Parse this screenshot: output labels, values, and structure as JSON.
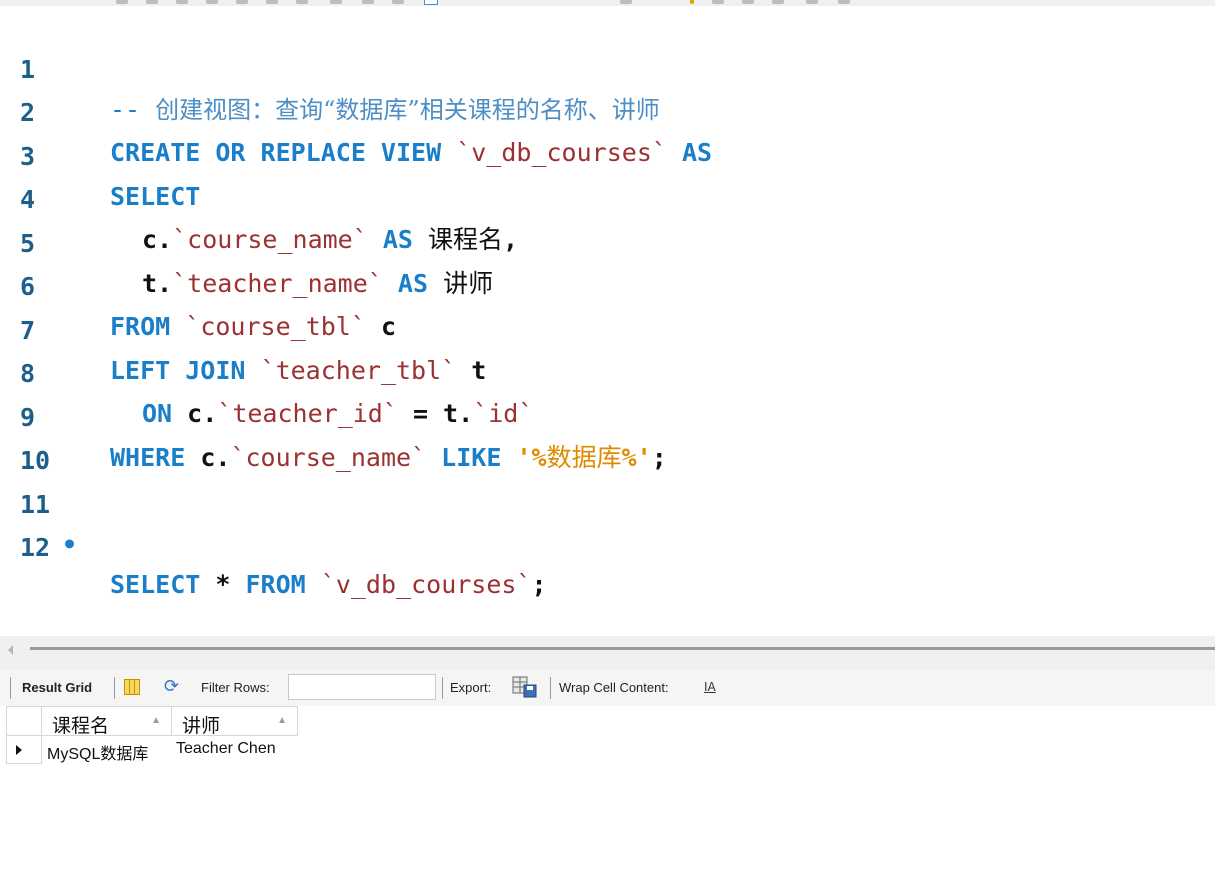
{
  "editor": {
    "lines": [
      {
        "no": "1",
        "comment_prefix": "-- ",
        "comment_text": "创建视图：查询“数据库”相关课程的名称、讲师"
      },
      {
        "no": "2",
        "kw1": "CREATE OR REPLACE VIEW",
        "id": "`v_db_courses`",
        "kw2": "AS"
      },
      {
        "no": "3",
        "kw": "SELECT"
      },
      {
        "no": "4",
        "pre": "c.",
        "id": "`course_name`",
        "kw": "AS",
        "alias": "课程名",
        "post": ","
      },
      {
        "no": "5",
        "pre": "t.",
        "id": "`teacher_name`",
        "kw": "AS",
        "alias": "讲师"
      },
      {
        "no": "6",
        "kw": "FROM",
        "id": "`course_tbl`",
        "post": "c"
      },
      {
        "no": "7",
        "kw": "LEFT JOIN",
        "id": "`teacher_tbl`",
        "post": "t"
      },
      {
        "no": "8",
        "kw": "ON",
        "pre1": "c.",
        "id1": "`teacher_id`",
        "mid": " = t.",
        "id2": "`id`"
      },
      {
        "no": "9",
        "kw1": "WHERE",
        "pre": "c.",
        "id": "`course_name`",
        "kw2": "LIKE",
        "s1": "'%",
        "s_cjk": "数据库",
        "s2": "%'",
        "post": ";"
      },
      {
        "no": "10"
      },
      {
        "no": "11",
        "marker": "•",
        "kw1": "SELECT",
        "star": "*",
        "kw2": "FROM",
        "id": "`v_db_courses`",
        "post": ";"
      },
      {
        "no": "12"
      }
    ]
  },
  "result_toolbar": {
    "result_grid_label": "Result Grid",
    "filter_rows_label": "Filter Rows:",
    "filter_value": "",
    "export_label": "Export:",
    "wrap_label": "Wrap Cell Content:",
    "wrap_icon_text": "IA"
  },
  "result_grid": {
    "columns": [
      {
        "label": "课程名",
        "sort": "▲"
      },
      {
        "label": "讲师",
        "sort": "▲"
      }
    ],
    "rows": [
      [
        "MySQL数据库",
        "Teacher Chen"
      ]
    ]
  },
  "colors": {
    "keyword": "#1a7ec8",
    "identifier": "#9b3131",
    "string": "#e08a00",
    "line_number": "#1d5f8a"
  }
}
